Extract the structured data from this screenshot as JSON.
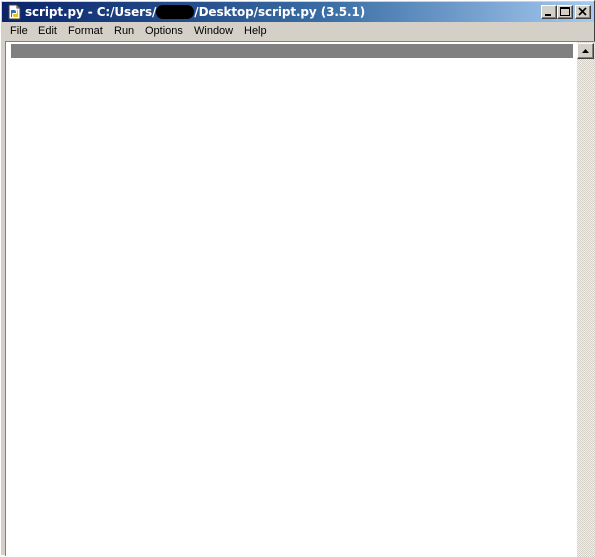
{
  "window": {
    "title_prefix": "script.py - C:/Users/",
    "title_suffix": "/Desktop/script.py (3.5.1)",
    "title_colors": {
      "active_start": "#0a246a",
      "active_end": "#a6caf0",
      "text": "#ffffff"
    },
    "controls": {
      "minimize_icon": "minimize-icon",
      "maximize_icon": "maximize-icon",
      "close_icon": "close-icon"
    }
  },
  "menubar": {
    "items": [
      {
        "label": "File"
      },
      {
        "label": "Edit"
      },
      {
        "label": "Format"
      },
      {
        "label": "Run"
      },
      {
        "label": "Options"
      },
      {
        "label": "Window"
      },
      {
        "label": "Help"
      }
    ]
  },
  "editor": {
    "content": "",
    "current_line_color": "#808080",
    "background": "#ffffff"
  },
  "scrollbar": {
    "up_arrow_icon": "arrow-up-icon"
  }
}
